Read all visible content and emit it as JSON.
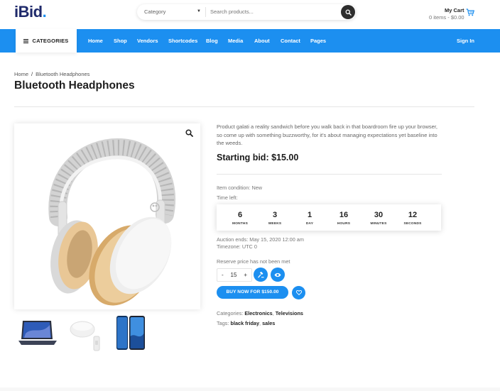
{
  "header": {
    "logo_main": "iBid",
    "logo_dot": ".",
    "search": {
      "category_label": "Category",
      "placeholder": "Search products..."
    },
    "cart": {
      "title": "My Cart",
      "summary": "0 items - $0.00"
    }
  },
  "nav": {
    "categories_label": "CATEGORIES",
    "items": [
      "Home",
      "Shop",
      "Vendors",
      "Shortcodes",
      "Blog",
      "Media",
      "About",
      "Contact",
      "Pages"
    ],
    "sign_in": "Sign In"
  },
  "breadcrumb": {
    "home": "Home",
    "separator": "/",
    "current": "Bluetooth Headphones"
  },
  "product": {
    "title": "Bluetooth Headphones",
    "description": "Product galati a reality sandwich before you walk back in that boardroom fire up your browser, so come up with something buzzworthy, for it's about managing expectations yet baseline into the weeds.",
    "starting_bid": "Starting bid: $15.00",
    "item_condition": "Item condition: New",
    "time_left_label": "Time left:",
    "countdown": [
      {
        "value": "6",
        "unit": "MONTHS"
      },
      {
        "value": "3",
        "unit": "WEEKS"
      },
      {
        "value": "1",
        "unit": "DAY"
      },
      {
        "value": "16",
        "unit": "HOURS"
      },
      {
        "value": "30",
        "unit": "MINUTES"
      },
      {
        "value": "12",
        "unit": "SECONDS"
      }
    ],
    "auction_ends": "Auction ends: May 15, 2020 12:00 am",
    "timezone": "Timezone: UTC 0",
    "reserve": "Reserve price has not been met",
    "quantity": {
      "minus": "-",
      "value": "15",
      "plus": "+"
    },
    "buy_now": "BUY NOW FOR $150.00",
    "categories_label": "Categories:",
    "categories": [
      "Electronics",
      "Televisions"
    ],
    "tags_label": "Tags:",
    "tags": [
      "black friday",
      "sales"
    ],
    "list_separator": ","
  },
  "colors": {
    "brand_blue": "#1c8ff0",
    "logo_navy": "#1f2a6b",
    "text_dark": "#1e1e1e"
  },
  "icons": {
    "search": "search-icon",
    "cart": "cart-icon",
    "menu": "hamburger-icon",
    "zoom": "magnifier-icon",
    "bid": "gavel-icon",
    "watch": "eye-icon",
    "wishlist": "heart-icon"
  }
}
